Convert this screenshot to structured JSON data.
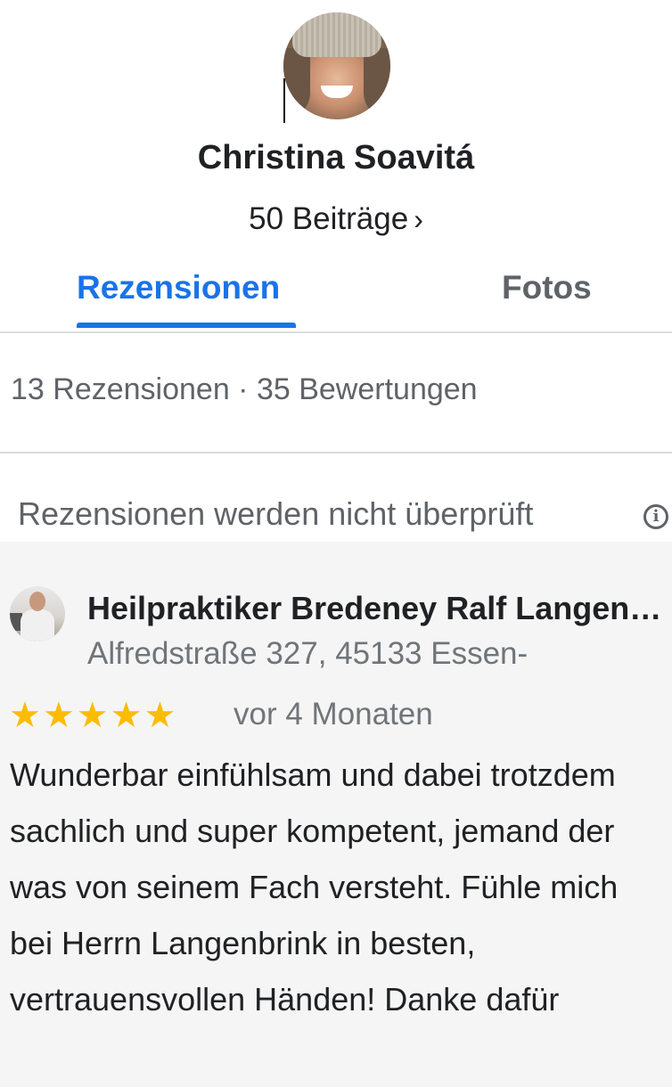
{
  "profile": {
    "name": "Christina Soavitá",
    "contributions": "50 Beiträge",
    "contributions_chevron": "›"
  },
  "tabs": {
    "reviews": "Rezensionen",
    "photos": "Fotos",
    "active": "Rezensionen"
  },
  "summary": {
    "counts": "13 Rezensionen · 35 Bewertungen",
    "notice": "Rezensionen werden nicht überprüft",
    "info_icon_glyph": "i"
  },
  "review": {
    "place_name": "Heilpraktiker Bredeney Ralf Langenbrink",
    "place_address": "Alfredstraße 327, 45133 Essen-",
    "rating": 5,
    "stars": "★★★★★",
    "time": "vor 4 Monaten",
    "text": "Wunderbar einfühlsam und dabei trotzdem sachlich und super kompetent, jemand der was von seinem Fach versteht. Fühle mich bei Herrn Langenbrink in besten, vertrauensvollen Händen! Danke dafür"
  },
  "colors": {
    "accent": "#1a73e8",
    "star": "#fbbc04",
    "secondary_text": "#5f6368",
    "card_background": "#f5f5f5"
  }
}
